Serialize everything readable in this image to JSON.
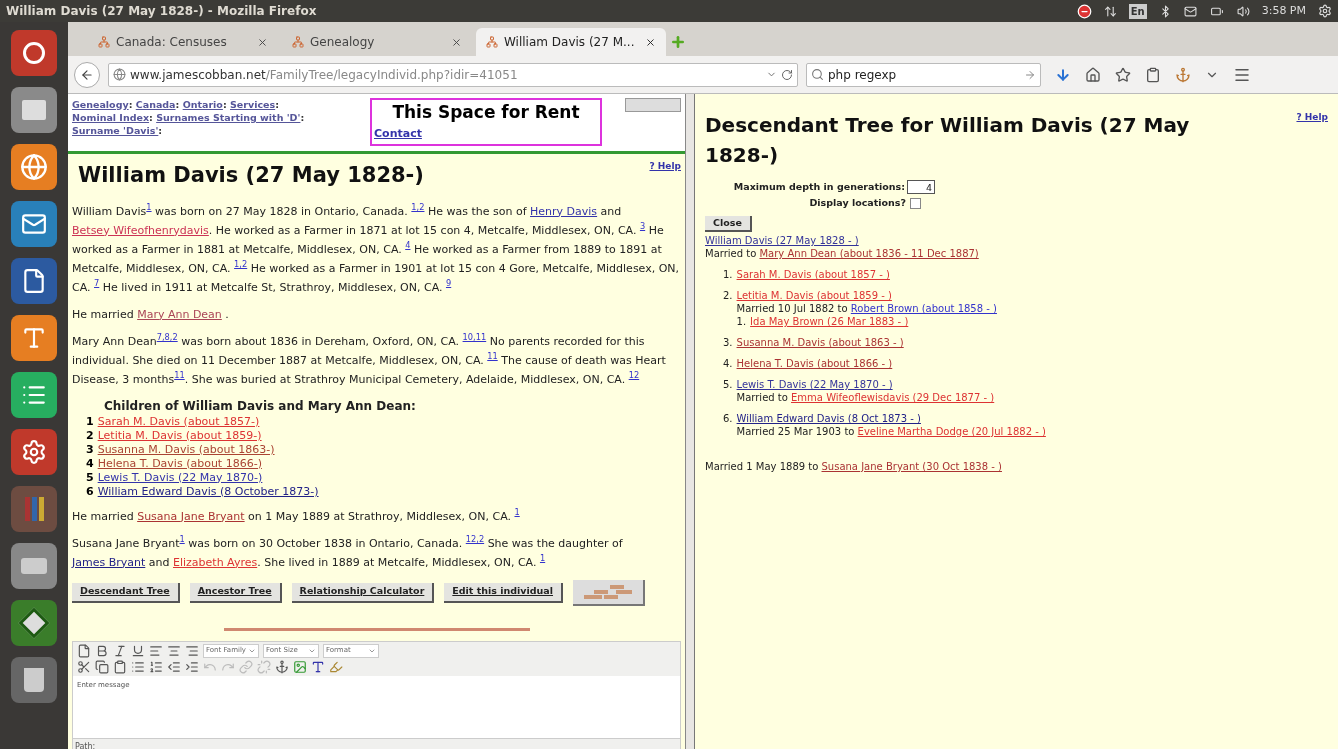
{
  "window": {
    "title": "William Davis (27 May 1828-) - Mozilla Firefox"
  },
  "tray": {
    "keyboard": "En",
    "time": "3:58 PM"
  },
  "tabs": [
    {
      "label": "Canada: Censuses",
      "selected": false
    },
    {
      "label": "Genealogy",
      "selected": false
    },
    {
      "label": "William Davis (27 M...",
      "selected": true
    }
  ],
  "address_bar": {
    "host": "www.jamescobban.net",
    "path": "/FamilyTree/legacyIndivid.php?idir=41051"
  },
  "search": {
    "value": "php regexp"
  },
  "left": {
    "breadcrumb": [
      {
        "kind": "link",
        "text": "Genealogy"
      },
      {
        "kind": "text",
        "text": ": "
      },
      {
        "kind": "link",
        "text": "Canada"
      },
      {
        "kind": "text",
        "text": ": "
      },
      {
        "kind": "link",
        "text": "Ontario"
      },
      {
        "kind": "text",
        "text": ": "
      },
      {
        "kind": "link",
        "text": "Services"
      },
      {
        "kind": "text",
        "text": ": "
      },
      {
        "kind": "link",
        "text": "Nominal Index"
      },
      {
        "kind": "text",
        "text": ": "
      },
      {
        "kind": "link",
        "text": "Surnames Starting with 'D'"
      },
      {
        "kind": "text",
        "text": ": "
      },
      {
        "kind": "link",
        "text": "Surname 'Davis'"
      },
      {
        "kind": "text",
        "text": ":"
      }
    ],
    "ad": {
      "title": "This Space for Rent",
      "link": "Contact"
    },
    "heading": "William Davis (27 May 1828-)",
    "help": "? Help",
    "paragraphs_a": [
      [
        {
          "kind": "text",
          "text": "William Davis"
        },
        {
          "kind": "sup",
          "text": "1"
        },
        {
          "kind": "text",
          "text": " was born on 27 May 1828 in Ontario, Canada. "
        },
        {
          "kind": "sup",
          "text": "1,2"
        },
        {
          "kind": "text",
          "text": " He was the son of "
        },
        {
          "kind": "link",
          "text": "Henry Davis",
          "color": "#3333aa"
        },
        {
          "kind": "text",
          "text": " and "
        },
        {
          "kind": "link",
          "text": "Betsey Wifeofhenrydavis",
          "color": "#cc3355"
        },
        {
          "kind": "text",
          "text": ". He worked as a Farmer in 1871 at lot 15 con 4, Metcalfe, Middlesex, ON, CA. "
        },
        {
          "kind": "sup",
          "text": "3"
        },
        {
          "kind": "text",
          "text": " He worked as a Farmer in 1881 at Metcalfe, Middlesex, ON, CA. "
        },
        {
          "kind": "sup",
          "text": "4"
        },
        {
          "kind": "text",
          "text": " He worked as a Farmer from 1889 to 1891 at Metcalfe, Middlesex, ON, CA. "
        },
        {
          "kind": "sup",
          "text": "1,2"
        },
        {
          "kind": "text",
          "text": " He worked as a Farmer in 1901 at lot 15 con 4 Gore, Metcalfe, Middlesex, ON, CA. "
        },
        {
          "kind": "sup",
          "text": "7"
        },
        {
          "kind": "text",
          "text": " He lived in 1911 at Metcalfe St, Strathroy, Middlesex, ON, CA. "
        },
        {
          "kind": "sup",
          "text": "9"
        }
      ],
      [
        {
          "kind": "text",
          "text": "He married "
        },
        {
          "kind": "link",
          "text": "Mary Ann Dean",
          "color": "#aa4455"
        },
        {
          "kind": "text",
          "text": " ."
        }
      ],
      [
        {
          "kind": "text",
          "text": "Mary Ann Dean"
        },
        {
          "kind": "sup",
          "text": "7,8,2"
        },
        {
          "kind": "text",
          "text": " was born about 1836 in Dereham, Oxford, ON, CA. "
        },
        {
          "kind": "sup",
          "text": "10,11"
        },
        {
          "kind": "text",
          "text": " No parents recorded for this individual. She died on 11 December 1887 at Metcalfe, Middlesex, ON, CA. "
        },
        {
          "kind": "sup",
          "text": "11"
        },
        {
          "kind": "text",
          "text": " The cause of death was Heart Disease, 3 months"
        },
        {
          "kind": "sup",
          "text": "11"
        },
        {
          "kind": "text",
          "text": ". She was buried at Strathroy Municipal Cemetery, Adelaide, Middlesex, ON, CA. "
        },
        {
          "kind": "sup",
          "text": "12"
        }
      ]
    ],
    "children_heading": "Children of William Davis and Mary Ann Dean:",
    "children": [
      {
        "number": "1",
        "text": "Sarah M. Davis (about 1857-)",
        "color": "#dd3333"
      },
      {
        "number": "2",
        "text": "Letitia M. Davis (about 1859-)",
        "color": "#dd3333"
      },
      {
        "number": "3",
        "text": "Susanna M. Davis (about 1863-)",
        "color": "#aa4433"
      },
      {
        "number": "4",
        "text": "Helena T. Davis (about 1866-)",
        "color": "#aa4433"
      },
      {
        "number": "5",
        "text": "Lewis T. Davis (22 May 1870-)",
        "color": "#3333aa"
      },
      {
        "number": "6",
        "text": "William Edward Davis (8 October 1873-)",
        "color": "#222288"
      }
    ],
    "paragraphs_b": [
      [
        {
          "kind": "text",
          "text": "He married "
        },
        {
          "kind": "link",
          "text": "Susana Jane Bryant",
          "color": "#aa3333"
        },
        {
          "kind": "text",
          "text": " on 1 May 1889 at Strathroy, Middlesex, ON, CA. "
        },
        {
          "kind": "sup",
          "text": "1"
        }
      ],
      [
        {
          "kind": "text",
          "text": "Susana Jane Bryant"
        },
        {
          "kind": "sup",
          "text": "1"
        },
        {
          "kind": "text",
          "text": " was born on 30 October 1838 in Ontario, Canada. "
        },
        {
          "kind": "sup",
          "text": "12,2"
        },
        {
          "kind": "text",
          "text": " She was the daughter of "
        },
        {
          "kind": "link",
          "text": "James Bryant",
          "color": "#222288"
        },
        {
          "kind": "text",
          "text": " and "
        },
        {
          "kind": "link",
          "text": "Elizabeth Ayres",
          "color": "#dd3333"
        },
        {
          "kind": "text",
          "text": ". She lived in 1889 at Metcalfe, Middlesex, ON, CA. "
        },
        {
          "kind": "sup",
          "text": "1"
        }
      ]
    ],
    "buttons": [
      "Descendant Tree",
      "Ancestor Tree",
      "Relationship Calculator",
      "Edit this individual"
    ],
    "editor": {
      "selects": [
        "Font Family",
        "Font Size",
        "Format"
      ],
      "content": "Enter message",
      "path": "Path:"
    }
  },
  "right": {
    "title": "Descendant Tree for William Davis (27 May 1828-)",
    "help": "? Help",
    "depth_label": "Maximum depth in generations:",
    "depth": "4",
    "locations_label": "Display locations?",
    "locations_checked": false,
    "close": "Close",
    "root": {
      "text": "William Davis (27 May 1828 - )",
      "color": "#333399"
    },
    "root_spouse": {
      "prefix": "Married to ",
      "text": "Mary Ann Dean (about 1836 - 11 Dec 1887)",
      "color": "#aa3333"
    },
    "tree": [
      {
        "number": "1.",
        "text": "Sarah M. Davis (about 1857 - )",
        "color": "#dd3333"
      },
      {
        "number": "2.",
        "text": "Letitia M. Davis (about 1859 - )",
        "color": "#dd3333",
        "spouse": {
          "prefix": "Married 10 Jul 1882 to ",
          "text": "Robert Brown (about 1858 - )",
          "color": "#3333cc"
        },
        "children": [
          {
            "number": "1.",
            "text": "Ida May Brown (26 Mar 1883 - )",
            "color": "#dd3333"
          }
        ]
      },
      {
        "number": "3.",
        "text": "Susanna M. Davis (about 1863 - )",
        "color": "#aa3333"
      },
      {
        "number": "4.",
        "text": "Helena T. Davis (about 1866 - )",
        "color": "#aa3333"
      },
      {
        "number": "5.",
        "text": "Lewis T. Davis (22 May 1870 - )",
        "color": "#333399",
        "spouse": {
          "prefix": "Married to ",
          "text": "Emma Wifeoflewisdavis (29 Dec 1877 - )",
          "color": "#dd3333"
        }
      },
      {
        "number": "6.",
        "text": "William Edward Davis (8 Oct 1873 - )",
        "color": "#222288",
        "spouse": {
          "prefix": "Married 25 Mar 1903 to ",
          "text": "Eveline Martha Dodge (20 Jul 1882 - )",
          "color": "#dd3333"
        }
      }
    ],
    "final_spouse": {
      "prefix": "Married 1 May 1889 to ",
      "text": "Susana Jane Bryant (30 Oct 1838 - )",
      "color": "#aa3333"
    }
  }
}
